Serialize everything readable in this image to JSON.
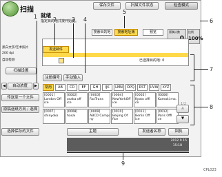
{
  "app": {
    "title": "扫描",
    "ready_line1": "就绪",
    "ready_line2": "指定目的地并按开始键。"
  },
  "header": {
    "save_file": "保存文件",
    "scan_file_status": "扫描文件状态",
    "check_mode": "检查模式"
  },
  "originals": {
    "label": "原稿计数",
    "count": "0",
    "ratio_label": "比例",
    "ratio": "100%"
  },
  "tabs": [
    "搜索目的地",
    "搜索地址簿",
    "预览"
  ],
  "left": {
    "info1": "黑白文字/艺术照片",
    "info2": "200 dpi",
    "info3": "自动检测",
    "scan_settings": "扫描设置",
    "auto_density": "自动浓度",
    "dest_text": "传送目的地",
    "send_one": "传送至一个文件",
    "stored_dest": "原稿送纸方向 / 选择",
    "select_stored": "选择保存的文件"
  },
  "dest": {
    "selected_label": "发送邮件",
    "count_text": "已选择目的地: 0"
  },
  "mid": {
    "enter_number": "注册编号",
    "manual_input": "手动输入"
  },
  "index_tabs": [
    "常用",
    "AB",
    "CD",
    "EF",
    "GH",
    "IJK",
    "LMN",
    "OPQ",
    "RST",
    "UVW",
    "XYZ"
  ],
  "cards": [
    [
      "[0001]",
      "London Off",
      "ice"
    ],
    [
      "[0002]",
      "osaka off",
      "ice"
    ],
    [
      "[0003]",
      "FaxTrans",
      ""
    ],
    [
      "[0004]",
      "NewYorkOff",
      "ice"
    ],
    [
      "[0005]",
      "Kyoto offi",
      "ce"
    ],
    [
      "[0006]",
      "Kamaki.ma.",
      ""
    ],
    [
      "[0007]",
      "shinyoko",
      ""
    ],
    [
      "[0008]",
      "hasai",
      ""
    ],
    [
      "[0009]",
      "ABCD Compa",
      "ny"
    ],
    [
      "[0010]",
      "Beijing Of",
      "fice"
    ],
    [
      "[0011]",
      "Berlin Off",
      "ice"
    ],
    [
      "[0012]",
      "Paris Offi",
      "ce"
    ]
  ],
  "page_indicator": "1/2",
  "bottom": {
    "subject": "主题",
    "sender_name": "发送者名称",
    "return": "回执"
  },
  "status": {
    "date": "2012 9 15",
    "time": "15:18"
  },
  "callouts": [
    "1",
    "2",
    "3",
    "4",
    "5",
    "6",
    "7",
    "8",
    "9"
  ],
  "figure_code": "CPL023"
}
